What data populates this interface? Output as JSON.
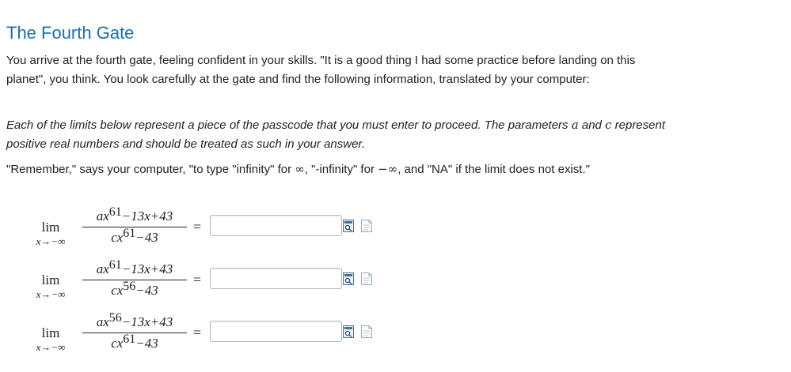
{
  "title": "The Fourth Gate",
  "intro_text": "You arrive at the fourth gate, feeling confident in your skills. \"It is a good thing I had some practice before landing on this planet\", you think. You look carefully at the gate and find the following information, translated by your computer:",
  "instructions": {
    "part1": "Each of the limits below represent a piece of the passcode that you must enter to proceed. The parameters ",
    "var_a": "a",
    "part2": " and ",
    "var_c": "c",
    "part3": " represent positive real numbers and should be treated as such in your answer."
  },
  "reminder": {
    "part1": "\"Remember,\" says your computer, \"to type \"infinity\" for ",
    "symbol_inf": "∞",
    "part2": ", \"-infinity\" for ",
    "symbol_neg_inf": "−∞",
    "part3": ", and \"NA\" if the limit does not exist.\""
  },
  "limits": [
    {
      "lim": "lim",
      "approach": "x→−∞",
      "num_base": "ax",
      "num_exp": "61",
      "num_rest": "−13x+43",
      "den_base": "cx",
      "den_exp": "61",
      "den_rest": "−43",
      "equals": "=",
      "answer_value": ""
    },
    {
      "lim": "lim",
      "approach": "x→−∞",
      "num_base": "ax",
      "num_exp": "61",
      "num_rest": "−13x+43",
      "den_base": "cx",
      "den_exp": "56",
      "den_rest": "−43",
      "equals": "=",
      "answer_value": ""
    },
    {
      "lim": "lim",
      "approach": "x→−∞",
      "num_base": "ax",
      "num_exp": "56",
      "num_rest": "−13x+43",
      "den_base": "cx",
      "den_exp": "61",
      "den_rest": "−43",
      "equals": "=",
      "answer_value": ""
    }
  ],
  "icons": {
    "preview": "preview-answer-icon",
    "help": "equation-help-icon"
  },
  "colors": {
    "title": "#1f6fa8",
    "text": "#222222",
    "input_border": "#b8b8b8"
  }
}
